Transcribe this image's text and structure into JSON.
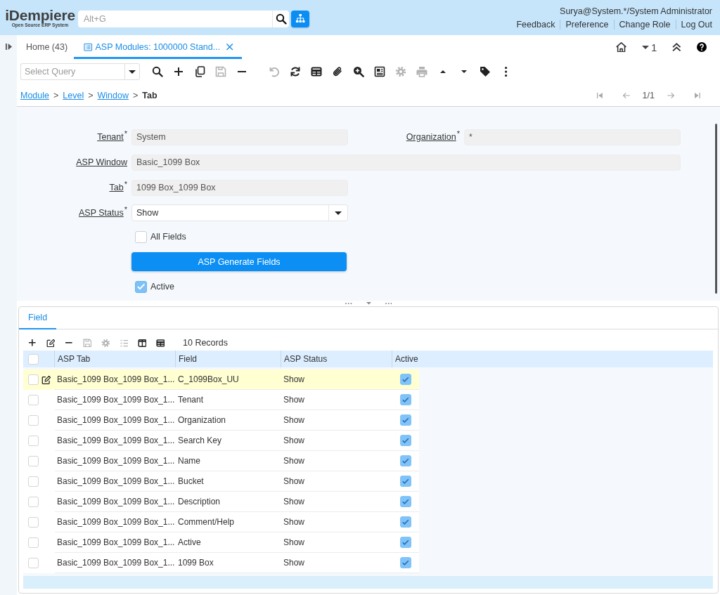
{
  "header": {
    "logo": {
      "name": "iDempiere",
      "tagline": "Open Source ERP System"
    },
    "search": {
      "placeholder": "Alt+G"
    },
    "user": "Surya@System.*/System Administrator",
    "links": [
      "Feedback",
      "Preference",
      "Change Role",
      "Log Out"
    ]
  },
  "tabs": [
    {
      "label": "Home (43)",
      "selected": false,
      "closable": false
    },
    {
      "label": "ASP Modules: 1000000 Stand...",
      "selected": true,
      "closable": true
    }
  ],
  "tab_tools": {
    "count": "1"
  },
  "toolbar": {
    "query": {
      "placeholder": "Select Query"
    },
    "groups": [
      [
        {
          "kind": "search",
          "disabled": false
        },
        {
          "kind": "new",
          "disabled": false
        },
        {
          "kind": "copy",
          "disabled": false
        },
        {
          "kind": "save",
          "disabled": true
        },
        {
          "kind": "delete",
          "disabled": false
        }
      ],
      [
        {
          "kind": "undo",
          "disabled": true
        },
        {
          "kind": "refresh",
          "disabled": false
        },
        {
          "kind": "grid",
          "disabled": false
        },
        {
          "kind": "attach",
          "disabled": false
        },
        {
          "kind": "zoom",
          "disabled": false
        },
        {
          "kind": "report",
          "disabled": false
        },
        {
          "kind": "process",
          "disabled": true
        },
        {
          "kind": "print",
          "disabled": true
        },
        {
          "kind": "previous",
          "disabled": false
        },
        {
          "kind": "next",
          "disabled": false
        },
        {
          "kind": "tag",
          "disabled": false
        },
        {
          "kind": "more",
          "disabled": false
        }
      ]
    ]
  },
  "breadcrumb": [
    {
      "label": "Module",
      "current": false
    },
    {
      "separator": ">",
      "label": "Level",
      "current": false
    },
    {
      "separator": ">",
      "label": "Window",
      "current": false
    },
    {
      "separator": ">",
      "label": "Tab",
      "current": true
    }
  ],
  "record_nav": {
    "position": "1/1",
    "buttons": [
      {
        "kind": "first",
        "disabled": true
      },
      {
        "kind": "back",
        "disabled": true
      },
      {
        "kind": "forward",
        "disabled": true
      },
      {
        "kind": "last",
        "disabled": true
      }
    ]
  },
  "form": {
    "rows": [
      [
        {
          "kind": "text",
          "label": "Tenant$^{*}$",
          "value": "System",
          "readonly": true
        },
        {
          "kind": "text",
          "label": "Organization$^{*}$",
          "value": "*",
          "readonly": true
        }
      ],
      [
        {
          "kind": "text",
          "label": "ASP Window",
          "value": "Basic_1099 Box",
          "readonly": true
        }
      ],
      [
        {
          "kind": "text",
          "label": "Tab$^{*}$",
          "value": "1099 Box_1099 Box",
          "readonly": true
        }
      ],
      [
        {
          "kind": "select",
          "label": "ASP Status$^{*}$",
          "value": "Show",
          "readonly": false
        }
      ],
      [
        {
          "kind": "checkbox",
          "label": "All Fields",
          "checked": false
        }
      ],
      [
        {
          "kind": "button",
          "label": "ASP Generate Fields"
        }
      ],
      [
        {
          "kind": "checkbox",
          "label": "Active",
          "checked": true
        }
      ]
    ]
  },
  "detail": {
    "tabs": [
      {
        "label": "Field",
        "selected": true
      }
    ],
    "toolbar": [
      {
        "kind": "new",
        "disabled": false
      },
      {
        "kind": "edit",
        "disabled": false
      },
      {
        "kind": "delete",
        "disabled": false
      },
      {
        "kind": "save",
        "disabled": true
      },
      {
        "kind": "process",
        "disabled": true
      },
      {
        "kind": "select",
        "disabled": true
      },
      {
        "kind": "split",
        "disabled": false
      },
      {
        "kind": "grid",
        "disabled": false
      }
    ],
    "record_count": "10 Records",
    "table": {
      "all_selected": false,
      "columns": [
        "ASP Tab",
        "Field",
        "ASP Status",
        "Active"
      ],
      "rows": [
        {
          "cells": [
            "Basic_1099 Box_1099 Box_1...",
            "C_1099Box_UU",
            "Show"
          ],
          "active": true,
          "selected": false,
          "current": true
        },
        {
          "cells": [
            "Basic_1099 Box_1099 Box_1...",
            "Tenant",
            "Show"
          ],
          "active": true,
          "selected": false,
          "current": false
        },
        {
          "cells": [
            "Basic_1099 Box_1099 Box_1...",
            "Organization",
            "Show"
          ],
          "active": true,
          "selected": false,
          "current": false
        },
        {
          "cells": [
            "Basic_1099 Box_1099 Box_1...",
            "Search Key",
            "Show"
          ],
          "active": true,
          "selected": false,
          "current": false
        },
        {
          "cells": [
            "Basic_1099 Box_1099 Box_1...",
            "Name",
            "Show"
          ],
          "active": true,
          "selected": false,
          "current": false
        },
        {
          "cells": [
            "Basic_1099 Box_1099 Box_1...",
            "Bucket",
            "Show"
          ],
          "active": true,
          "selected": false,
          "current": false
        },
        {
          "cells": [
            "Basic_1099 Box_1099 Box_1...",
            "Description",
            "Show"
          ],
          "active": true,
          "selected": false,
          "current": false
        },
        {
          "cells": [
            "Basic_1099 Box_1099 Box_1...",
            "Comment/Help",
            "Show"
          ],
          "active": true,
          "selected": false,
          "current": false
        },
        {
          "cells": [
            "Basic_1099 Box_1099 Box_1...",
            "Active",
            "Show"
          ],
          "active": true,
          "selected": false,
          "current": false
        },
        {
          "cells": [
            "Basic_1099 Box_1099 Box_1...",
            "1099 Box",
            "Show"
          ],
          "active": true,
          "selected": false,
          "current": false
        }
      ]
    }
  }
}
